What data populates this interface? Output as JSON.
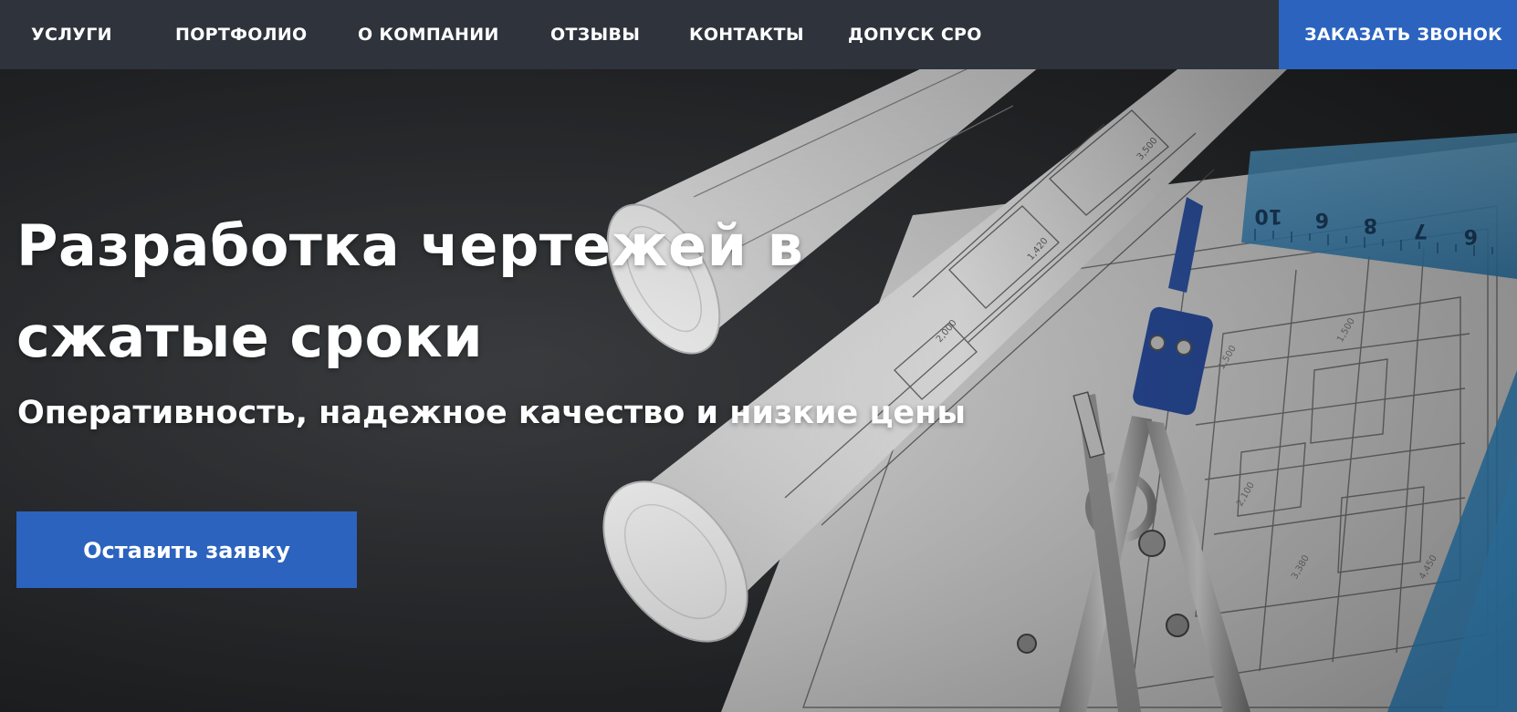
{
  "nav": {
    "items": [
      {
        "label": "УСЛУГИ"
      },
      {
        "label": "ПОРТФОЛИО"
      },
      {
        "label": "О КОМПАНИИ"
      },
      {
        "label": "ОТЗЫВЫ"
      },
      {
        "label": "КОНТАКТЫ"
      },
      {
        "label": "ДОПУСК СРО"
      }
    ],
    "call_button": "ЗАКАЗАТЬ ЗВОНОК"
  },
  "hero": {
    "title_line1": "Разработка чертежей в",
    "title_line2": "сжатые сроки",
    "subtitle": "Оперативность, надежное качество и низкие цены",
    "cta_label": "Оставить заявку",
    "image": "blueprints-compass-ruler-photo"
  },
  "colors": {
    "nav_background": "#2e333c",
    "accent": "#2b63bf",
    "text": "#ffffff",
    "hero_background": "#2b2d30"
  }
}
